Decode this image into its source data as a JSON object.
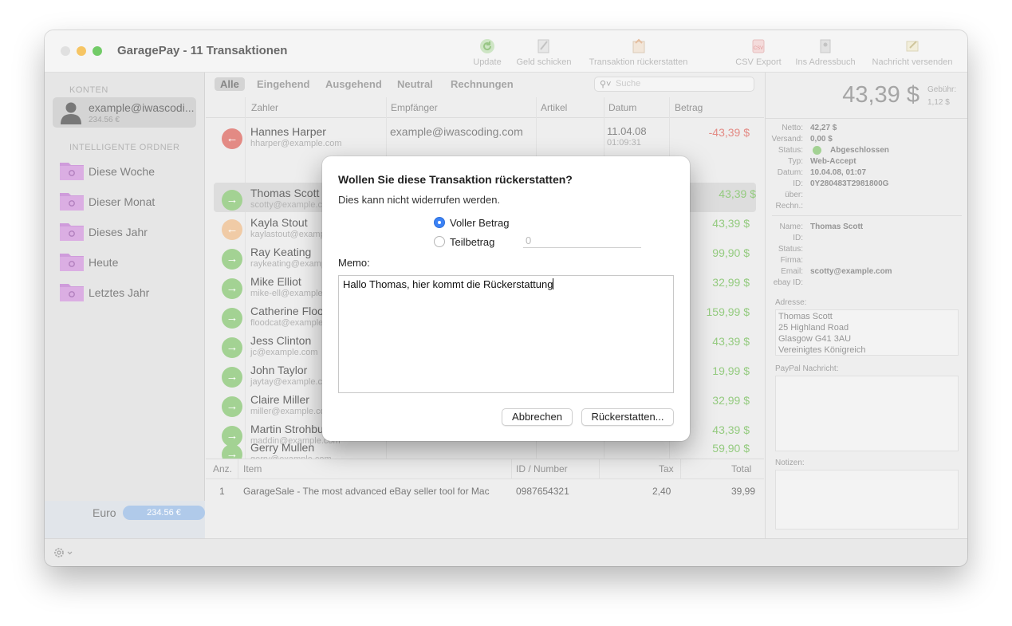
{
  "window": {
    "title": "GaragePay - 11 Transaktionen"
  },
  "toolbar": {
    "buttons": [
      {
        "label": "Update",
        "icon": "refresh-icon"
      },
      {
        "label": "Geld schicken",
        "icon": "send-money-icon"
      },
      {
        "label": "Transaktion rückerstatten",
        "icon": "refund-icon"
      },
      {
        "label": "CSV Export",
        "icon": "csv-export-icon"
      },
      {
        "label": "Ins Adressbuch",
        "icon": "address-book-icon"
      },
      {
        "label": "Nachricht versenden",
        "icon": "message-icon"
      }
    ]
  },
  "sidebar": {
    "accounts_heading": "KONTEN",
    "account": {
      "name": "example@iwascodi...",
      "balance": "234.56 €"
    },
    "smart_heading": "INTELLIGENTE ORDNER",
    "folders": [
      "Diese Woche",
      "Dieser Monat",
      "Dieses Jahr",
      "Heute",
      "Letztes Jahr"
    ],
    "currency_label": "Euro",
    "currency_value": "234.56 €"
  },
  "filters": {
    "tabs": [
      "Alle",
      "Eingehend",
      "Ausgehend",
      "Neutral",
      "Rechnungen"
    ],
    "active": "Alle",
    "search_placeholder": "Suche"
  },
  "table": {
    "columns": [
      "Zahler",
      "Empfänger",
      "Artikel",
      "Datum",
      "Betrag"
    ],
    "rows": [
      {
        "name": "Hannes Harper",
        "email": "hharper@example.com",
        "recipient": "example@iwascoding.com",
        "date": "11.04.08",
        "time": "01:09:31",
        "amount": "-43,39 $",
        "kind": "outgoing"
      },
      {
        "name": "Thomas Scott",
        "email": "scotty@example.com",
        "recipient": "",
        "date": "",
        "time": "",
        "amount": "43,39 $",
        "kind": "incoming"
      },
      {
        "name": "Kayla Stout",
        "email": "kaylastout@example.com",
        "recipient": "",
        "date": "",
        "time": "",
        "amount": "43,39 $",
        "kind": "refunded"
      },
      {
        "name": "Ray Keating",
        "email": "raykeating@example.com",
        "recipient": "",
        "date": "",
        "time": "",
        "amount": "99,90 $",
        "kind": "incoming"
      },
      {
        "name": "Mike Elliot",
        "email": "mike-ell@example.com",
        "recipient": "",
        "date": "",
        "time": "",
        "amount": "32,99 $",
        "kind": "incoming"
      },
      {
        "name": "Catherine Flood",
        "email": "floodcat@example.com",
        "recipient": "",
        "date": "",
        "time": "",
        "amount": "159,99 $",
        "kind": "incoming"
      },
      {
        "name": "Jess Clinton",
        "email": "jc@example.com",
        "recipient": "",
        "date": "",
        "time": "",
        "amount": "43,39 $",
        "kind": "incoming"
      },
      {
        "name": "John Taylor",
        "email": "jaytay@example.com",
        "recipient": "",
        "date": "",
        "time": "",
        "amount": "19,99 $",
        "kind": "incoming"
      },
      {
        "name": "Claire Miller",
        "email": "miller@example.com",
        "recipient": "",
        "date": "",
        "time": "",
        "amount": "32,99 $",
        "kind": "incoming"
      },
      {
        "name": "Martin Strohbusch",
        "email": "maddin@example.com",
        "recipient": "",
        "date": "",
        "time": "",
        "amount": "43,39 $",
        "kind": "incoming"
      },
      {
        "name": "Gerry Mullen",
        "email": "gerry@example.com",
        "recipient": "",
        "date": "",
        "time": "",
        "amount": "59,90 $",
        "kind": "incoming"
      }
    ],
    "selected_row": 1
  },
  "items": {
    "columns": [
      "Anz.",
      "Item",
      "ID / Number",
      "Tax",
      "Total"
    ],
    "rows": [
      {
        "qty": "1",
        "item": "GarageSale - The most advanced eBay seller tool for Mac",
        "id": "0987654321",
        "tax": "2,40",
        "total": "39,99"
      }
    ]
  },
  "details": {
    "amount": "43,39 $",
    "fee_label": "Gebühr:",
    "fee_value": "1,12 $",
    "transaction": [
      {
        "key": "Netto:",
        "value": "42,27 $"
      },
      {
        "key": "Versand:",
        "value": "0,00 $"
      },
      {
        "key": "Status:",
        "value": "Abgeschlossen"
      },
      {
        "key": "Typ:",
        "value": "Web-Accept"
      },
      {
        "key": "Datum:",
        "value": "10.04.08, 01:07"
      },
      {
        "key": "ID:",
        "value": "0Y280483T2981800G"
      },
      {
        "key": "über:",
        "value": ""
      },
      {
        "key": "Rechn.:",
        "value": ""
      }
    ],
    "payer": [
      {
        "key": "Name:",
        "value": "Thomas Scott"
      },
      {
        "key": "ID:",
        "value": ""
      },
      {
        "key": "Status:",
        "value": ""
      },
      {
        "key": "Firma:",
        "value": ""
      },
      {
        "key": "Email:",
        "value": "scotty@example.com"
      },
      {
        "key": "ebay ID:",
        "value": ""
      }
    ],
    "address_label": "Adresse:",
    "address": [
      "Thomas Scott",
      "25 Highland Road",
      "Glasgow G41 3AU",
      "Vereinigtes Königreich"
    ],
    "paypal_msg_label": "PayPal Nachricht:",
    "notes_label": "Notizen:"
  },
  "dialog": {
    "title": "Wollen Sie diese Transaktion rückerstatten?",
    "subtitle": "Dies kann nicht widerrufen werden.",
    "option_full": "Voller Betrag",
    "option_partial": "Teilbetrag",
    "partial_placeholder": "0",
    "memo_label": "Memo:",
    "memo_text": "Hallo Thomas, hier kommt die Rückerstattung",
    "cancel_label": "Abbrechen",
    "confirm_label": "Rückerstatten...",
    "selected_option": "full"
  },
  "colors": {
    "positive": "#86c46e",
    "negative": "#e07a73",
    "accent": "#3b82f6",
    "folder": "#c98fd6"
  }
}
